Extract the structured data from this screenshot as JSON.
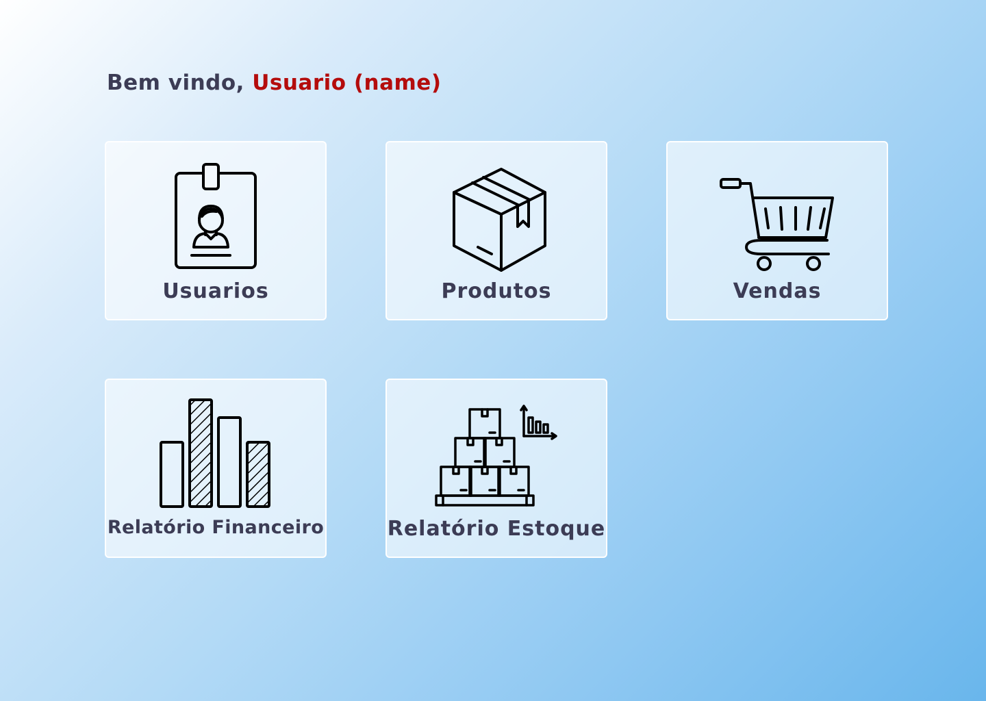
{
  "welcome": {
    "greeting": "Bem vindo,",
    "user_name": "Usuario (name)"
  },
  "cards": [
    {
      "label": "Usuarios",
      "icon": "id-badge-icon"
    },
    {
      "label": "Produtos",
      "icon": "box-icon"
    },
    {
      "label": "Vendas",
      "icon": "shopping-cart-icon"
    },
    {
      "label": "Relatório Financeiro",
      "icon": "bar-chart-icon"
    },
    {
      "label": "Relatório Estoque",
      "icon": "stock-boxes-icon"
    }
  ],
  "colors": {
    "text": "#3c3c55",
    "user_name": "#b40c0c",
    "card_border": "#ffffff",
    "background_start": "#ffffff",
    "background_end": "#69b6ec"
  }
}
